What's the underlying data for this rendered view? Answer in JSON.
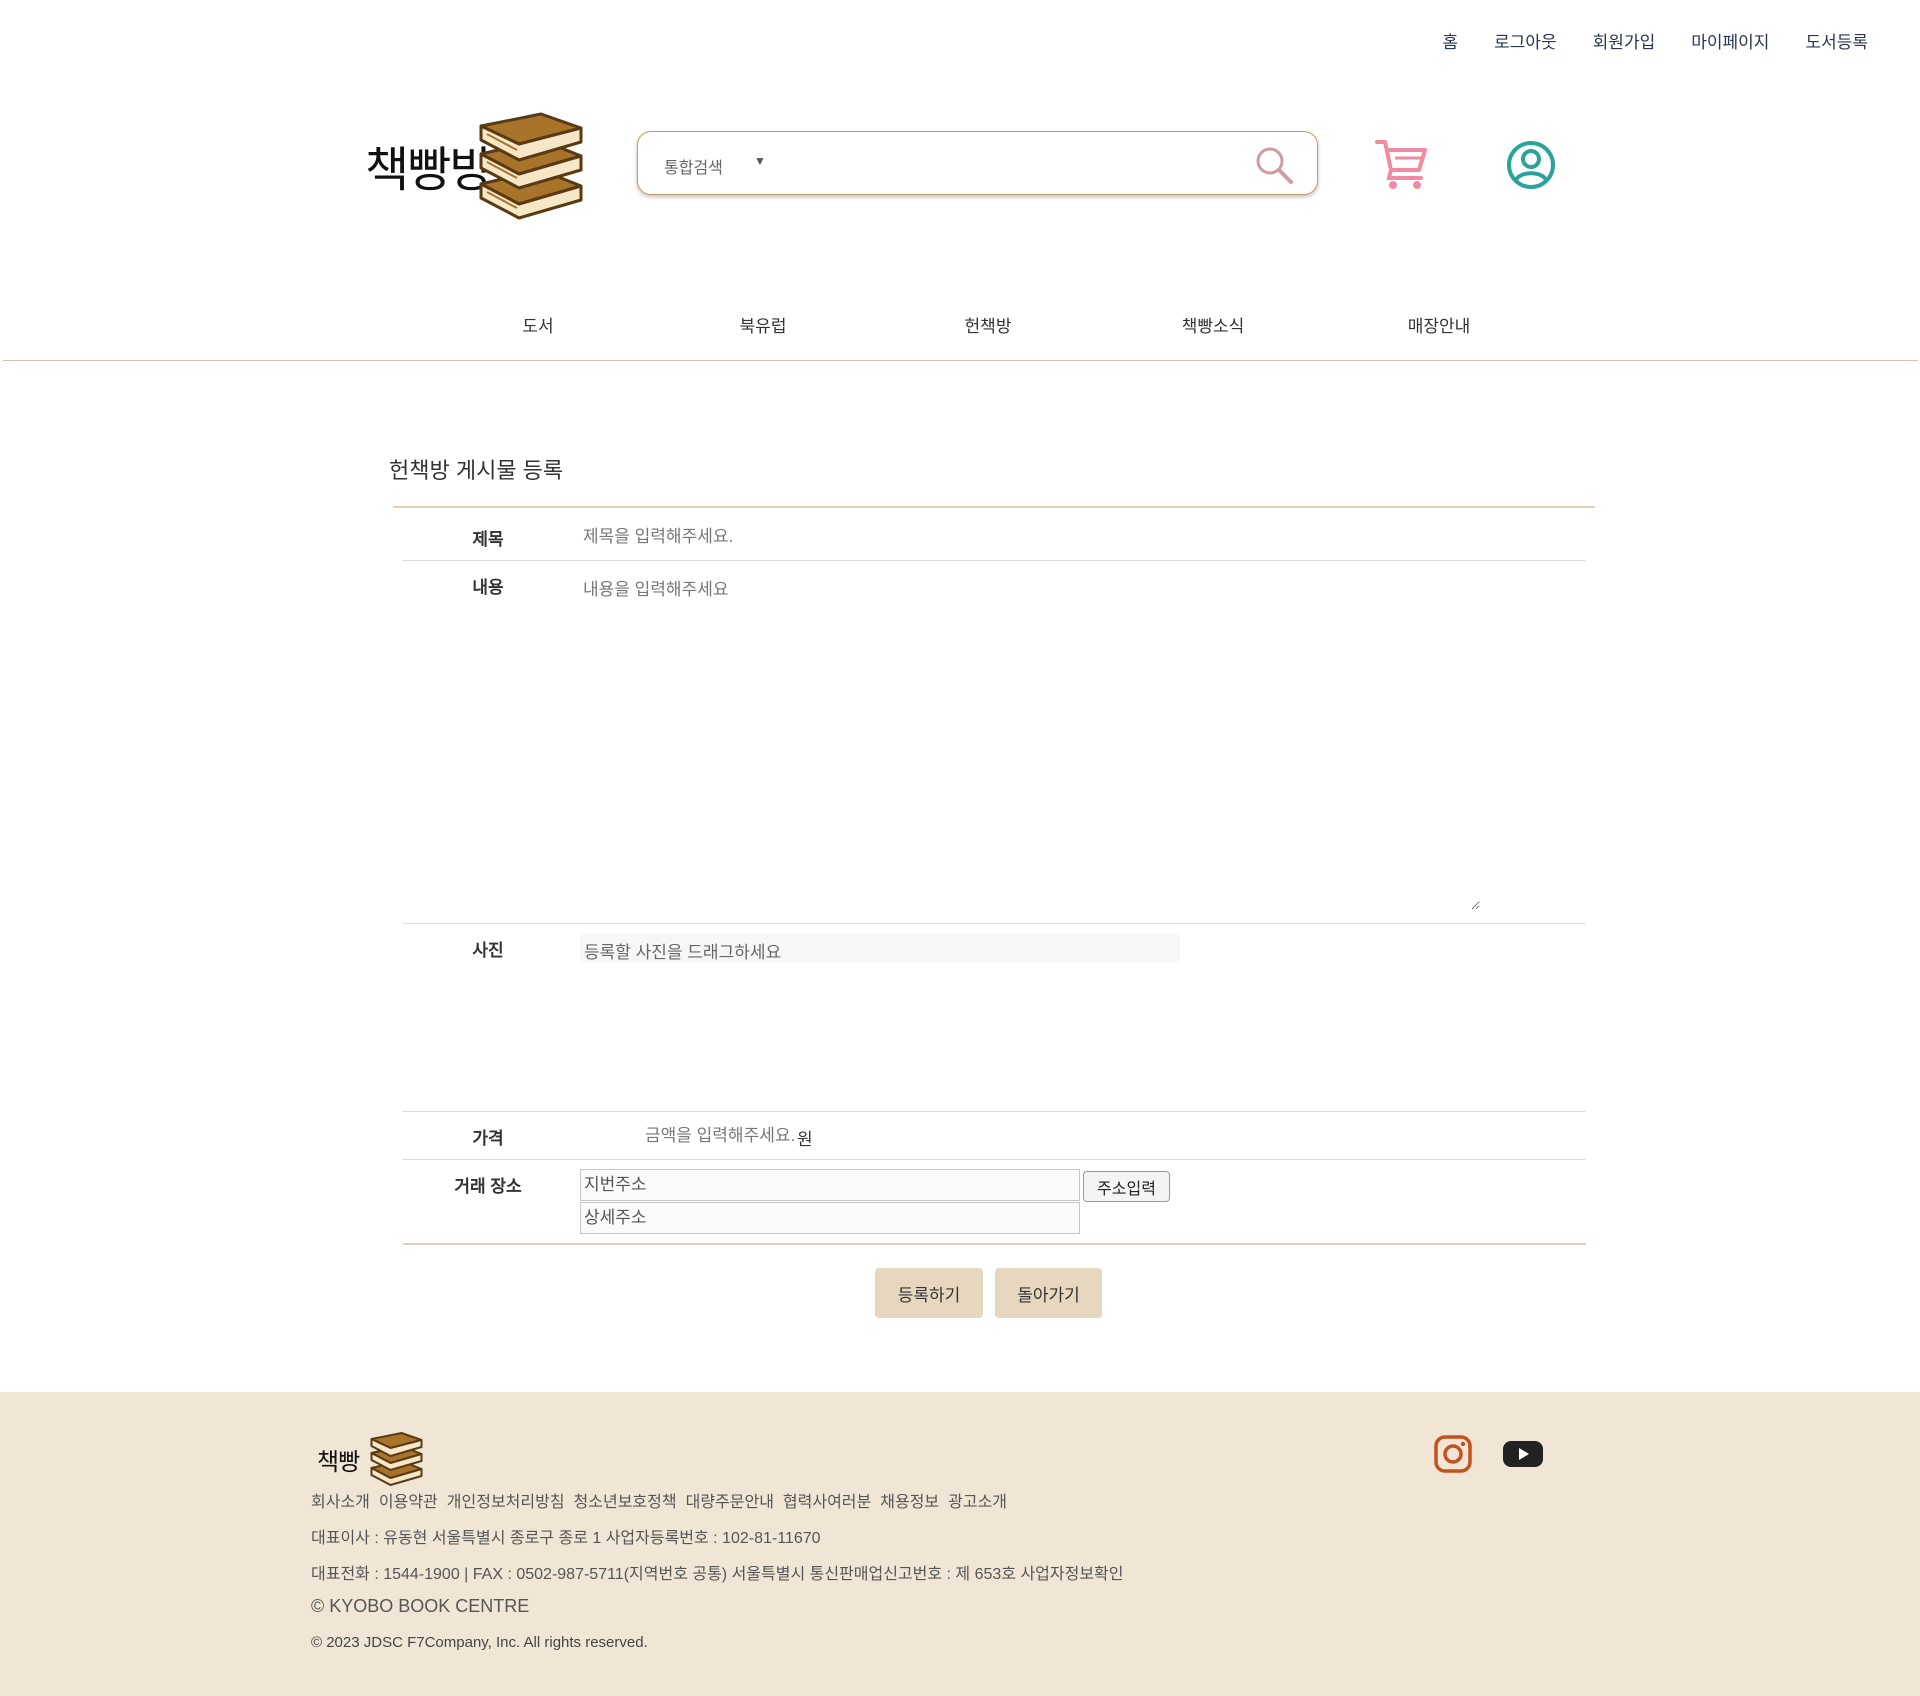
{
  "top_links": [
    "홈",
    "로그아웃",
    "회원가입",
    "마이페이지",
    "도서등록"
  ],
  "logo_text": "책빵방",
  "search": {
    "category": "통합검색",
    "placeholder": ""
  },
  "nav": [
    "도서",
    "북유럽",
    "헌책방",
    "책빵소식",
    "매장안내"
  ],
  "colors": {
    "accent_brown": "#a8742c",
    "cart_pink": "#f28ba0",
    "user_teal": "#2aa39a",
    "footer_bg": "#f1e6d6",
    "button_bg": "#e7d7bf"
  },
  "form": {
    "title": "헌책방 게시물 등록",
    "title_label": "제목",
    "title_placeholder": "제목을 입력해주세요.",
    "content_label": "내용",
    "content_placeholder": "내용을 입력해주세요",
    "photo_label": "사진",
    "photo_placeholder": "등록할 사진을 드래그하세요",
    "price_label": "가격",
    "price_placeholder": "금액을 입력해주세요.",
    "price_unit": "원",
    "place_label": "거래 장소",
    "address_placeholder": "지번주소",
    "detail_placeholder": "상세주소",
    "address_button": "주소입력",
    "submit_button": "등록하기",
    "back_button": "돌아가기"
  },
  "footer": {
    "logo_text": "책빵",
    "links": [
      "회사소개",
      "이용약관",
      "개인정보처리방침",
      "청소년보호정책",
      "대량주문안내",
      "협력사여러분",
      "채용정보",
      "광고소개"
    ],
    "line1": "대표이사 : 유동현 서울특별시 종로구 종로 1 사업자등록번호 : 102-81-11670",
    "line2": "대표전화 : 1544-1900 | FAX : 0502-987-5711(지역번호 공통) 서울특별시 통신판매업신고번호 : 제 653호 사업자정보확인",
    "line3": "© KYOBO BOOK CENTRE",
    "line4": "© 2023 JDSC F7Company, Inc. All rights reserved.",
    "icons": [
      "instagram-icon",
      "youtube-icon"
    ]
  }
}
